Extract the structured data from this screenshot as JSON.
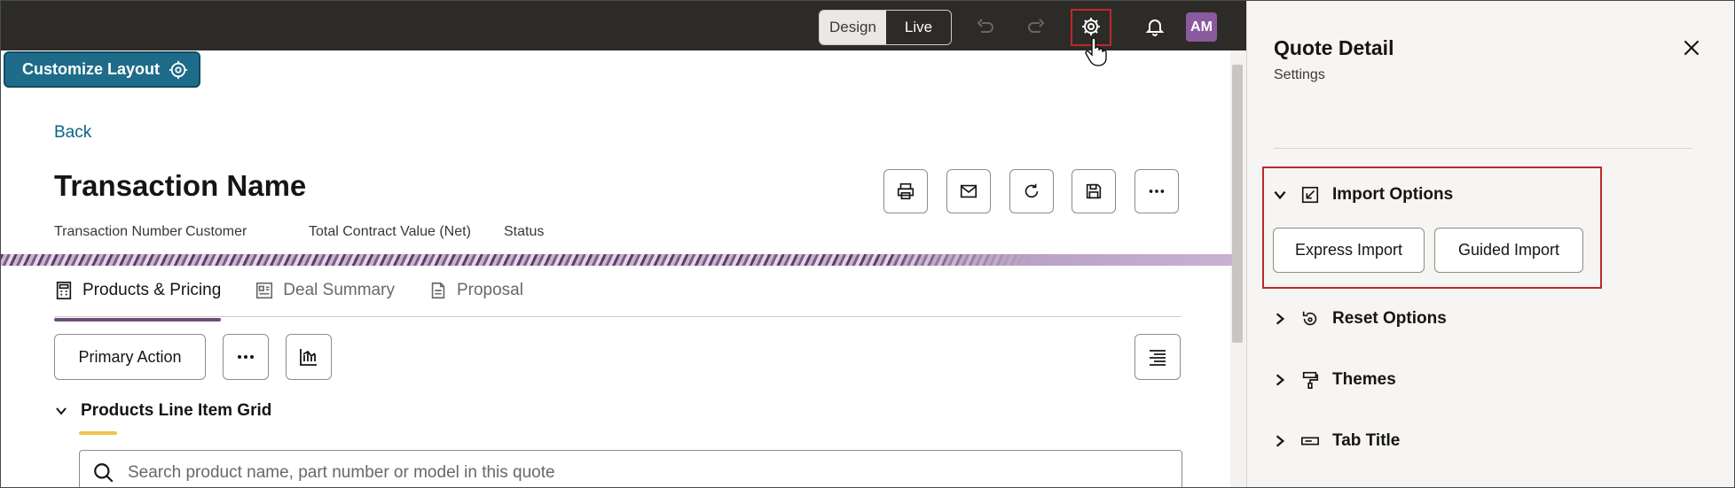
{
  "topbar": {
    "mode_design": "Design",
    "mode_live": "Live",
    "user_initials": "AM",
    "icons": [
      "undo-icon",
      "redo-icon",
      "gear-icon",
      "bell-icon"
    ]
  },
  "customize_label": "Customize Layout",
  "back_label": "Back",
  "transaction": {
    "title": "Transaction Name",
    "meta": [
      "Transaction Number",
      "Customer",
      "Total Contract Value (Net)",
      "Status"
    ]
  },
  "tabs": [
    {
      "label": "Products & Pricing",
      "active": true
    },
    {
      "label": "Deal Summary",
      "active": false
    },
    {
      "label": "Proposal",
      "active": false
    }
  ],
  "toolbar": {
    "primary_action": "Primary Action"
  },
  "grid": {
    "section_title": "Products Line Item Grid",
    "search_placeholder": "Search product name, part number or model in this quote"
  },
  "panel": {
    "title": "Quote Detail",
    "subtitle": "Settings",
    "sections": [
      {
        "label": "Import Options",
        "expanded": true,
        "buttons": [
          "Express Import",
          "Guided Import"
        ]
      },
      {
        "label": "Reset Options",
        "expanded": false
      },
      {
        "label": "Themes",
        "expanded": false
      },
      {
        "label": "Tab Title",
        "expanded": false
      }
    ]
  },
  "colors": {
    "topbar": "#2d2b28",
    "accent_teal": "#1e6b8a",
    "tab_active": "#6c4e7a",
    "highlight": "#c0282a",
    "avatar": "#8a5a9e"
  }
}
